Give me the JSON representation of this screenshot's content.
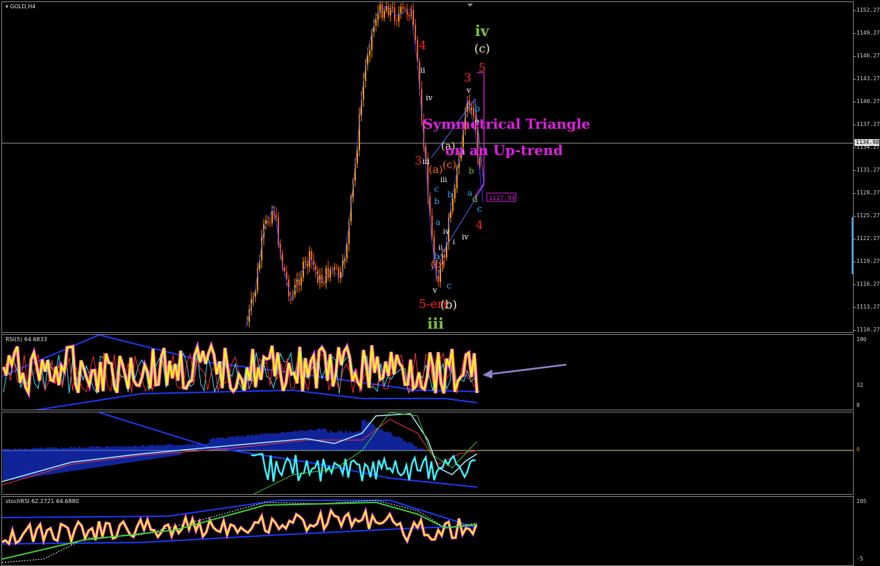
{
  "main": {
    "symbol_label": "GOLD,H4",
    "current_price": "1134.98",
    "line_price_label": "1127.94",
    "price_axis": [
      "1152.27",
      "1149.27",
      "1146.27",
      "1143.27",
      "1140.27",
      "1137.27",
      "1134.27",
      "1131.27",
      "1128.27",
      "1125.27",
      "1122.27",
      "1119.27",
      "1116.27",
      "1113.27",
      "1110.27"
    ],
    "annotation_line1": "Symmetrical Triangle",
    "annotation_line2": "on an Up-trend",
    "wave_labels": {
      "iv_big": "iv",
      "c_top": "(c)",
      "five_top": "5",
      "four_top": "4",
      "three_red": "3",
      "ii_1": "ii",
      "iv_1": "iv",
      "three_left": "3",
      "iii_1": "iii",
      "a_paren": "(a)",
      "a_orange": "(a)",
      "c_orange": "(c)",
      "b_orange": "(b)",
      "v_small": "v",
      "five_err": "5-err",
      "b_paren": "(b)",
      "iii_big": "iii",
      "c_blue": "c",
      "four_red": "4",
      "iv_2": "iv",
      "v_top": "v",
      "b_blue": "b",
      "e_tri": "e",
      "d_tri": "d",
      "c_tri": "c",
      "b_tri": "b",
      "a_tri": "a"
    }
  },
  "rsi": {
    "label": "RSI(5) 64.6833",
    "axis": [
      "100",
      "32",
      "0"
    ]
  },
  "macd": {
    "axis_marker": "0"
  },
  "stochrsi": {
    "label": "stochRSI 62.2721 64.6880",
    "axis": [
      "105",
      "-5"
    ]
  },
  "colors": {
    "bull": "#ff9a00",
    "bear": "#ff5a1a",
    "wave_line": "#2a44ff",
    "annotation": "#e020e0",
    "rsi_main": "#ffff00",
    "rsi_glow": "#ff40ff",
    "macd_hist": "#1a3cff",
    "macd_fast": "#40f0ff"
  }
}
